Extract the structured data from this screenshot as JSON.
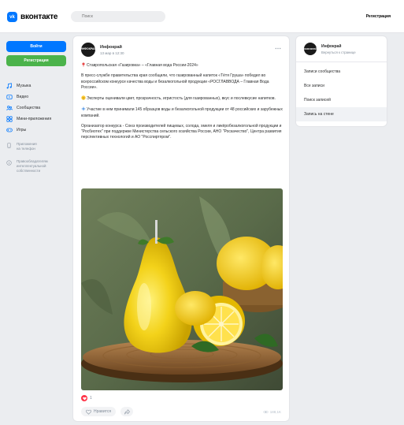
{
  "header": {
    "logo_mark": "vk",
    "logo_text": "вконтакте",
    "search_placeholder": "Поиск",
    "register_link": "Регистрация"
  },
  "left": {
    "login_button": "Войти",
    "register_button": "Регистрация",
    "menu": [
      {
        "label": "Музыка",
        "icon": "music-icon"
      },
      {
        "label": "Видео",
        "icon": "video-icon"
      },
      {
        "label": "Сообщества",
        "icon": "communities-icon"
      },
      {
        "label": "Мини-приложения",
        "icon": "mini-apps-icon"
      },
      {
        "label": "Игры",
        "icon": "games-icon"
      }
    ],
    "sub_menu": [
      {
        "label": "Приложения\nна телефон",
        "icon": "phone-icon"
      },
      {
        "label": "Правообладателям\nинтеллектуальной\nсобственности",
        "icon": "info-icon"
      }
    ]
  },
  "post": {
    "avatar_text": "ИНФОКРАЙ",
    "author": "Инфокрай",
    "date": "13 мар в 12:30",
    "paragraphs": [
      "Ставропольская «Газировка» – «Главная вода России-2024»",
      "В пресс-службе правительства края сообщили, что газированный напиток «Тётя Груша» победил во всероссийском конкурсе качества воды и безалкогольной продукции «РОСГЛАВВОДА – Главная Вода России».",
      "Эксперты оценивали цвет, прозрачность, игристость (для газированных), вкус и послевкусие напитков.",
      "Участие в нем принимали 145 образцов воды и безалкогольной продукции от 48 российских и зарубежных компаний.",
      "Организатор конкурса - Союз производителей пищевых, солода, хмеля и ликёробезалкогольной продукции и \"Росбиотех\" при поддержке Министерства сельского хозяйства России, АНО \"Роскачество\", Центра развития перспективных технологий и АО \"Росспиртпром\"."
    ],
    "reaction_count": "1",
    "like_label": "Нравится",
    "views": "188,1K"
  },
  "right": {
    "avatar_text": "ИНФОКРАЙ",
    "title": "Инфокрай",
    "subtitle": "Вернуться к странице",
    "items": [
      {
        "label": "Записи сообщества",
        "active": false
      },
      {
        "label": "Все записи",
        "active": false
      },
      {
        "label": "Поиск записей",
        "active": false
      },
      {
        "label": "Запись на стене",
        "active": true
      }
    ]
  },
  "colors": {
    "brand": "#0077ff",
    "register": "#4bb34b",
    "reaction": "#ff3347",
    "background": "#ebedf0"
  }
}
